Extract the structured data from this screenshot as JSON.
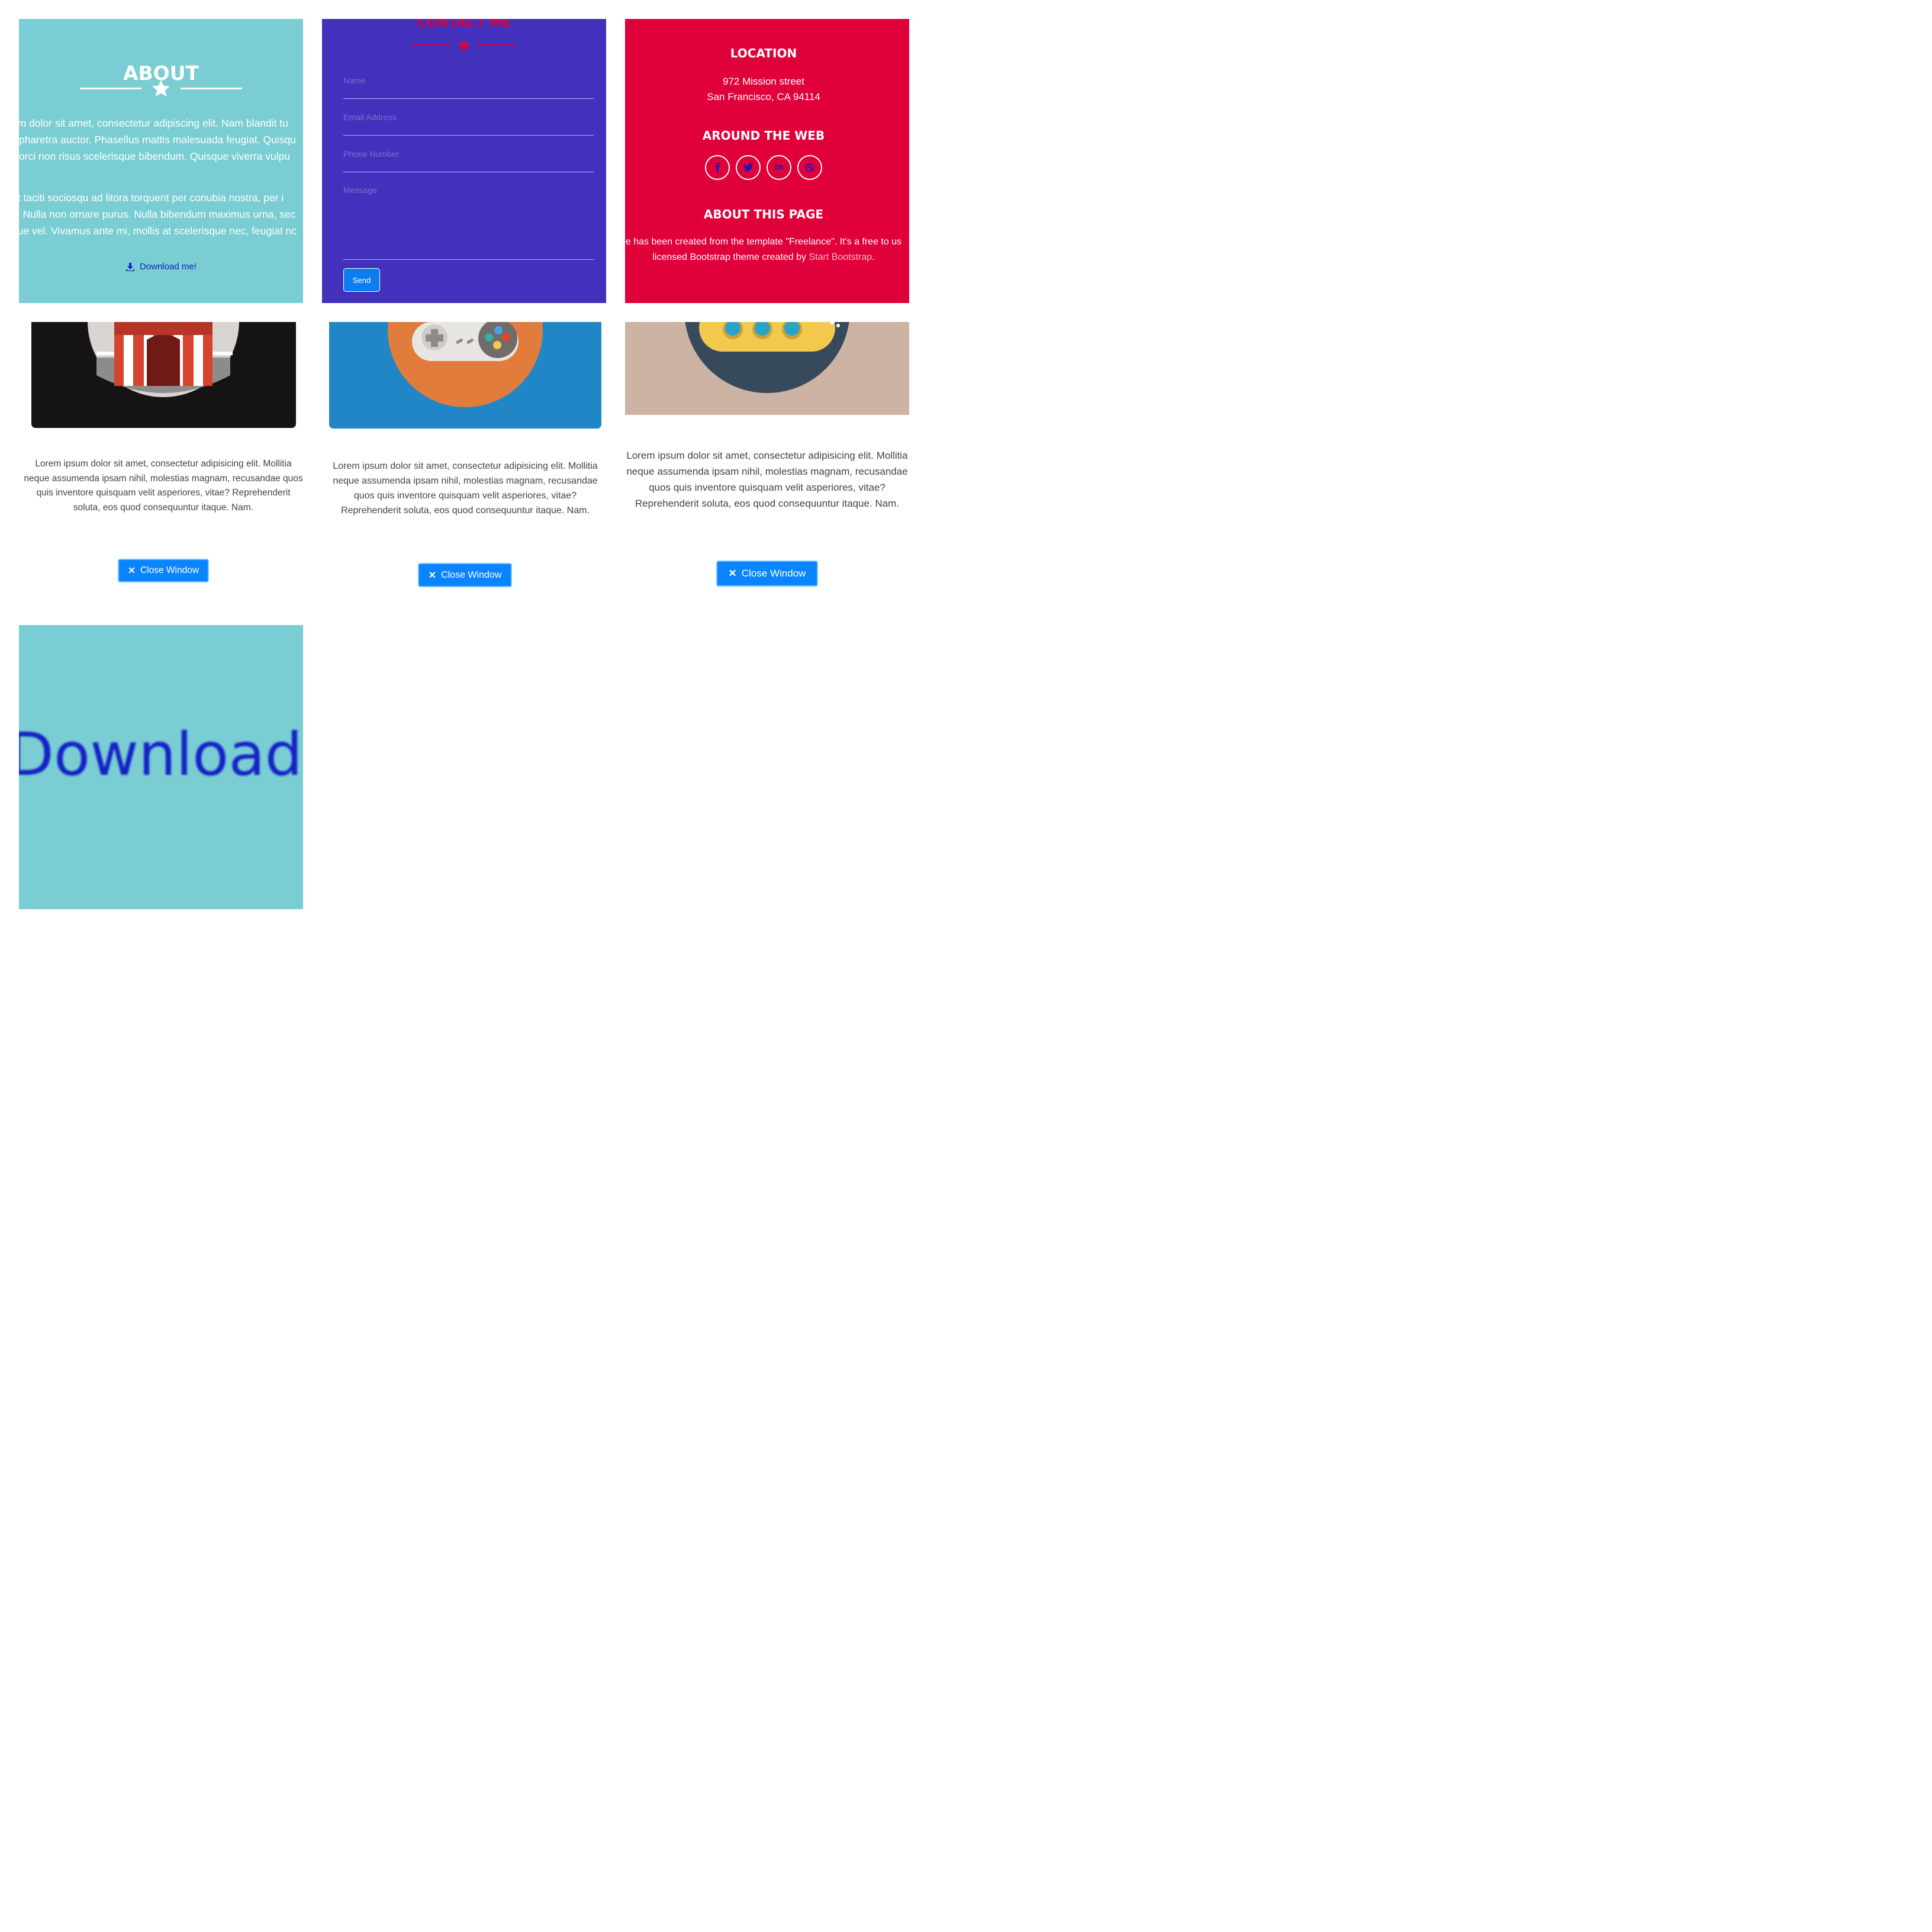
{
  "about": {
    "title": "ABOUT",
    "paragraph1": [
      "um dolor sit amet, consectetur adipiscing elit. Nam blandit tu",
      "pharetra auctor. Phasellus mattis malesuada feugiat. Quisqu",
      "orci non risus scelerisque bibendum. Quisque viverra vulpu"
    ],
    "paragraph2": [
      "nt taciti sociosqu ad litora torquent per conubia nostra, per i",
      "s. Nulla non ornare purus. Nulla bibendum maximus urna, sec",
      "que vel. Vivamus ante mi, mollis at scelerisque nec, feugiat nc"
    ],
    "download_label": "Download me!",
    "background": "#79cdd3"
  },
  "contact": {
    "title": "CONTACT ME",
    "fields": {
      "name": "Name",
      "email": "Email Address",
      "phone": "Phone Number",
      "message": "Message"
    },
    "send_label": "Send",
    "background": "#4131bd",
    "accent": "#e0003a"
  },
  "location": {
    "heading": "LOCATION",
    "address_line1": "972 Mission street",
    "address_line2": "San Francisco, CA 94114",
    "web_heading": "AROUND THE WEB",
    "social": [
      "facebook-icon",
      "twitter-icon",
      "linkedin-icon",
      "dribbble-icon"
    ],
    "linkedin_text": "in",
    "about_heading": "ABOUT THIS PAGE",
    "about_line1": "e has been created from the template \"Freelance\". It's a free to us",
    "about_line2_prefix": "licensed Bootstrap theme created by ",
    "about_link": "Start Bootstrap",
    "about_line2_suffix": ".",
    "background": "#e0003a"
  },
  "cards": [
    {
      "image": "circus-tent-illustration",
      "description": "Lorem ipsum dolor sit amet, consectetur adipisicing elit. Mollitia neque assumenda ipsam nihil, molestias magnam, recusandae quos quis inventore quisquam velit asperiores, vitae? Reprehenderit soluta, eos quod consequuntur itaque. Nam.",
      "close_label": "Close Window"
    },
    {
      "image": "game-controller-illustration",
      "description": "Lorem ipsum dolor sit amet, consectetur adipisicing elit. Mollitia neque assumenda ipsam nihil, molestias magnam, recusandae quos quis inventore quisquam velit asperiores, vitae? Reprehenderit soluta, eos quod consequuntur itaque. Nam.",
      "close_label": "Close Window"
    },
    {
      "image": "submarine-illustration",
      "description": "Lorem ipsum dolor sit amet, consectetur adipisicing elit. Mollitia neque assumenda ipsam nihil, molestias magnam, recusandae quos quis inventore quisquam velit asperiores, vitae? Reprehenderit soluta, eos quod consequuntur itaque. Nam.",
      "close_label": "Close Window"
    }
  ],
  "zoom": {
    "text": "Download r"
  }
}
